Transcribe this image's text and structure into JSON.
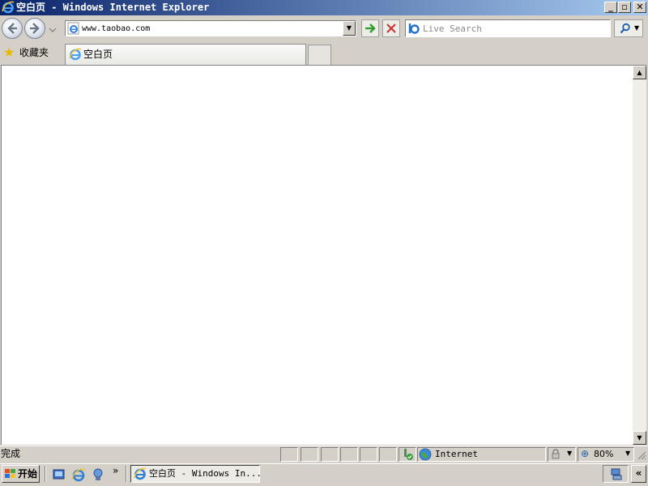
{
  "window": {
    "title": "空白页 - Windows Internet Explorer",
    "caption_buttons": {
      "minimize": "_",
      "restore": "▫",
      "close": "✕"
    }
  },
  "nav": {
    "back_icon": "back-arrow-icon",
    "forward_icon": "forward-arrow-icon",
    "address_value": "www.taobao.com",
    "go_icon": "green-arrow-icon",
    "stop_icon": "red-x-icon",
    "search_placeholder": "Live Search",
    "search_icon": "magnifier-icon"
  },
  "favorites": {
    "label": "收藏夹"
  },
  "tabs": [
    {
      "label": "空白页",
      "active": true
    }
  ],
  "status": {
    "text": "完成",
    "zone": "Internet",
    "zoom": "80%"
  },
  "taskbar": {
    "start_label": "开始",
    "window_button_label": "空白页 - Windows In...",
    "chevron": "»",
    "tray_chevron": "«"
  },
  "colors": {
    "titlebar_start": "#0a246a",
    "titlebar_end": "#a6caf0",
    "chrome": "#d4d0c8",
    "go_green": "#2e9e2e",
    "stop_red": "#c83232"
  }
}
